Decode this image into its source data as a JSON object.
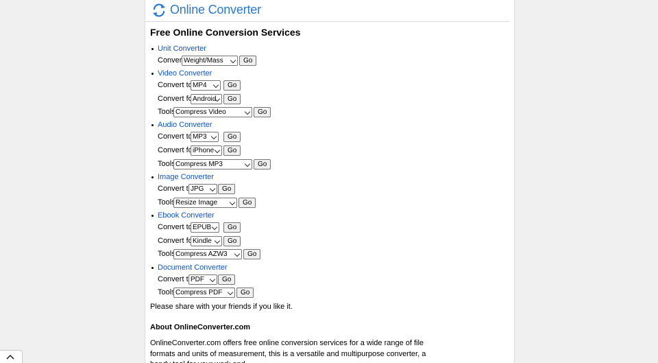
{
  "site": {
    "logo_text": "Online Converter"
  },
  "heading": "Free Online Conversion Services",
  "sections": {
    "unit": {
      "link": "Unit Converter",
      "r1": {
        "label": "Convert",
        "value": "Weight/Mass",
        "go": "Go"
      }
    },
    "video": {
      "link": "Video Converter",
      "r1": {
        "label": "Convert to",
        "value": "MP4",
        "go": "Go"
      },
      "r2": {
        "label": "Convert for",
        "value": "Android",
        "go": "Go"
      },
      "r3": {
        "label": "Tools",
        "value": "Compress Video",
        "go": "Go"
      }
    },
    "audio": {
      "link": "Audio Converter",
      "r1": {
        "label": "Convert to",
        "value": "MP3",
        "go": "Go"
      },
      "r2": {
        "label": "Convert for",
        "value": "iPhone",
        "go": "Go"
      },
      "r3": {
        "label": "Tools",
        "value": "Compress MP3",
        "go": "Go"
      }
    },
    "image": {
      "link": "Image Converter",
      "r1": {
        "label": "Convert to",
        "value": "JPG",
        "go": "Go"
      },
      "r2": {
        "label": "Tools",
        "value": "Resize Image",
        "go": "Go"
      }
    },
    "ebook": {
      "link": "Ebook Converter",
      "r1": {
        "label": "Convert to",
        "value": "EPUB",
        "go": "Go"
      },
      "r2": {
        "label": "Convert for",
        "value": "Kindle",
        "go": "Go"
      },
      "r3": {
        "label": "Tools",
        "value": "Compress AZW3",
        "go": "Go"
      }
    },
    "doc": {
      "link": "Document Converter",
      "r1": {
        "label": "Convert to",
        "value": "PDF",
        "go": "Go"
      },
      "r2": {
        "label": "Tools",
        "value": "Compress PDF",
        "go": "Go"
      }
    }
  },
  "share_text": "Please share with your friends if you like it.",
  "about": {
    "heading": "About OnlineConverter.com",
    "text": "OnlineConverter.com offers free online conversion services for a wide range of file formats and units of measurement, this is a versatile and multipurpose converter, a handy tool for your work and"
  },
  "colors": {
    "link": "#1155cc",
    "logo": "#2a7ad5"
  },
  "icons": {
    "logo": "converter-arrows-icon",
    "back_to_top": "chevron-up-icon"
  }
}
